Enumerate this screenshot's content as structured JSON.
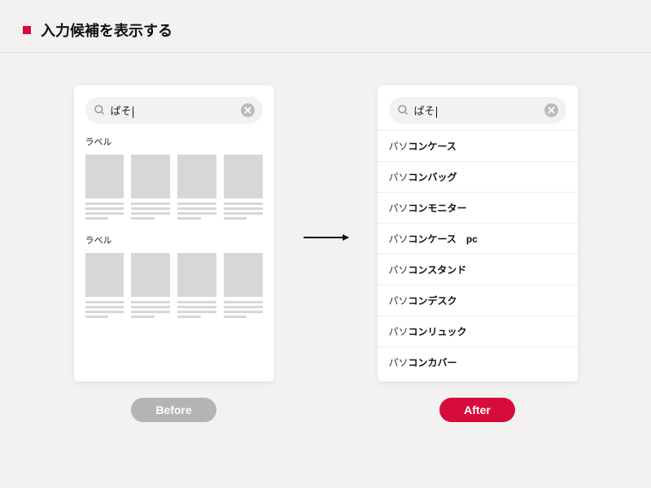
{
  "header": {
    "title": "入力候補を表示する"
  },
  "search": {
    "query": "ぱそ"
  },
  "before": {
    "label": "ラベル",
    "pill": "Before"
  },
  "after": {
    "pill": "After",
    "suggestions": [
      {
        "light": "パソ",
        "bold": "コンケース"
      },
      {
        "light": "パソ",
        "bold": "コンバッグ"
      },
      {
        "light": "パソ",
        "bold": "コンモニター"
      },
      {
        "light": "パソ",
        "bold": "コンケース　pc"
      },
      {
        "light": "パソ",
        "bold": "コンスタンド"
      },
      {
        "light": "パソ",
        "bold": "コンデスク"
      },
      {
        "light": "パソ",
        "bold": "コンリュック"
      },
      {
        "light": "パソ",
        "bold": "コンカバー"
      }
    ]
  }
}
